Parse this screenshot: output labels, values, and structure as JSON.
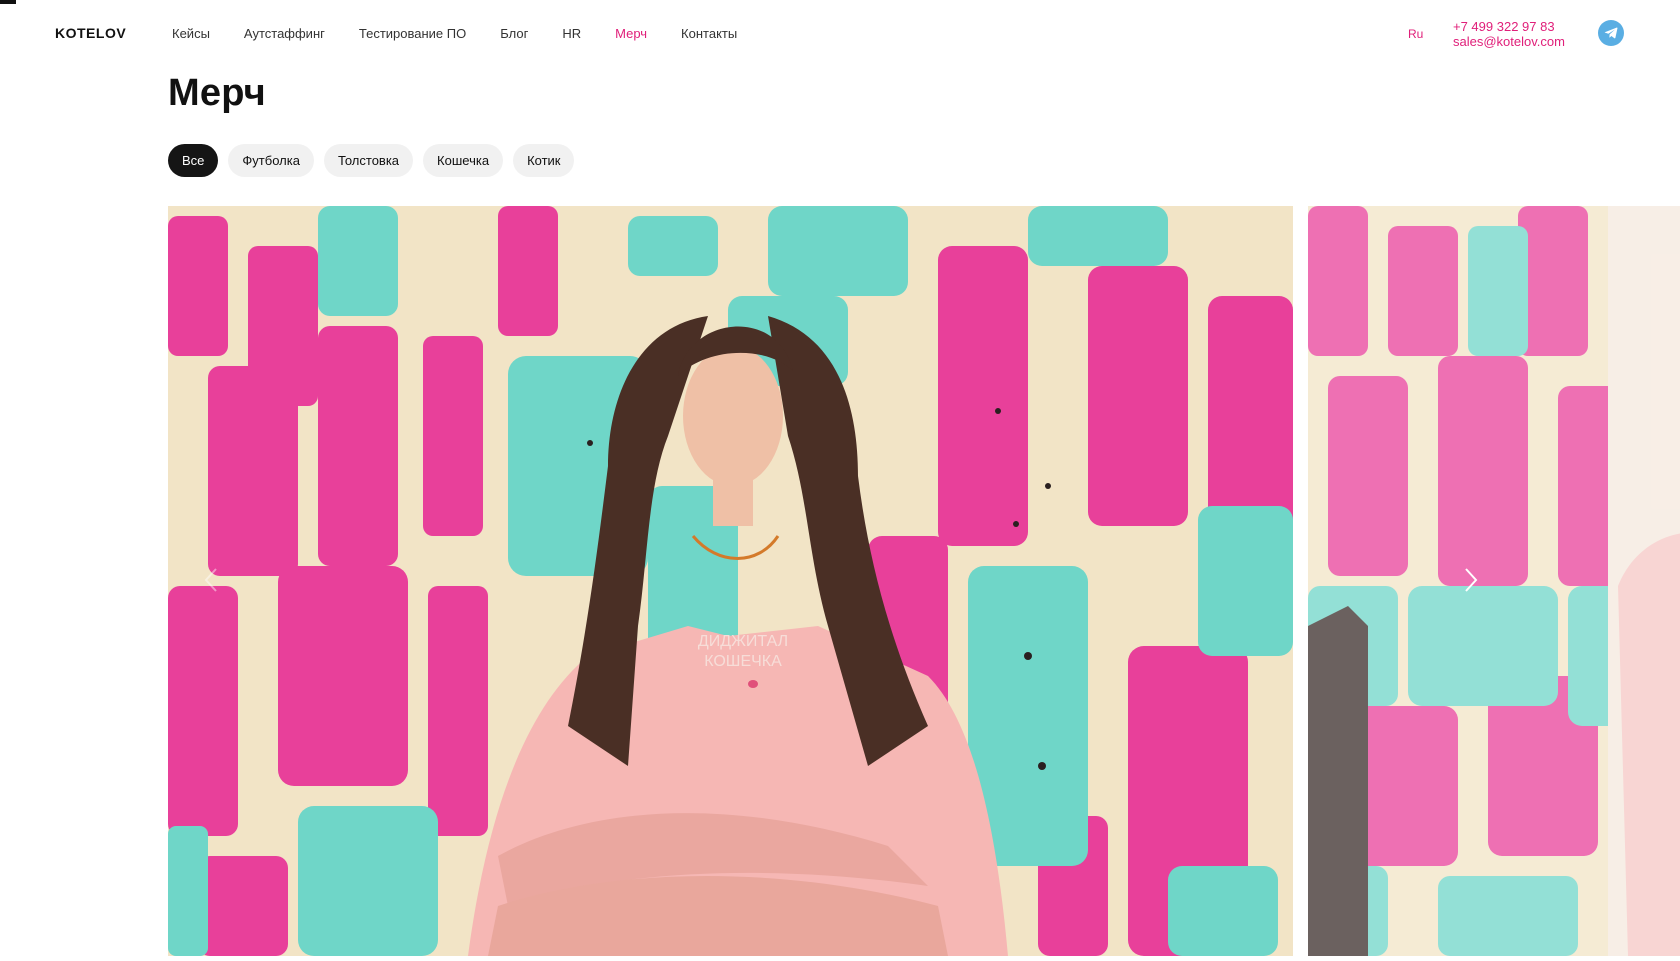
{
  "header": {
    "logo": "KOTELOV",
    "nav": [
      {
        "label": "Кейсы",
        "active": false
      },
      {
        "label": "Аутстаффинг",
        "active": false
      },
      {
        "label": "Тестирование ПО",
        "active": false
      },
      {
        "label": "Блог",
        "active": false
      },
      {
        "label": "HR",
        "active": false
      },
      {
        "label": "Мерч",
        "active": true
      },
      {
        "label": "Контакты",
        "active": false
      }
    ],
    "lang": "Ru",
    "phone": "+7 499 322 97 83",
    "email": "sales@kotelov.com",
    "telegram_icon": "telegram-icon"
  },
  "page": {
    "title": "Мерч"
  },
  "filters": [
    {
      "label": "Все",
      "active": true
    },
    {
      "label": "Футболка",
      "active": false
    },
    {
      "label": "Толстовка",
      "active": false
    },
    {
      "label": "Кошечка",
      "active": false
    },
    {
      "label": "Котик",
      "active": false
    }
  ],
  "slider": {
    "current_slide": {
      "shirt_print_line1": "ДИДЖИТАЛ",
      "shirt_print_line2": "КОШЕЧКА"
    },
    "prev_icon": "chevron-left-icon",
    "next_icon": "chevron-right-icon"
  },
  "colors": {
    "accent": "#e0207a",
    "graffiti_pink": "#e8409a",
    "graffiti_teal": "#6fd6c8",
    "wall_cream": "#f2e4c6",
    "shirt_pink": "#f6b7b4",
    "telegram": "#5aaee3"
  }
}
